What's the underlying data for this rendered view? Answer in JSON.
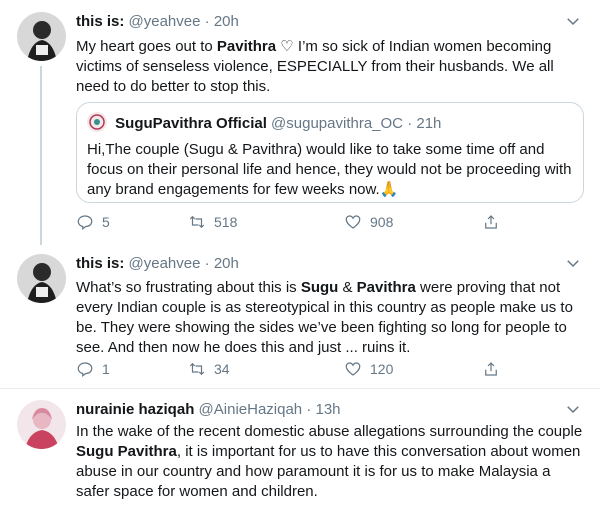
{
  "tweets": [
    {
      "name": "this is:",
      "handle": "@yeahvee",
      "time": "20h",
      "text_parts": [
        "My heart goes out to ",
        "Pavithra",
        " ♡ I’m so sick of Indian women becoming victims of senseless violence, ESPECIALLY from their husbands. We all need to do better to stop this."
      ],
      "quote": {
        "name": "SuguPavithra Official",
        "handle": "@sugupavithra_OC",
        "time": "21h",
        "text": "Hi,The couple (Sugu & Pavithra) would like to take some time off and focus on their personal life and hence, they would not be proceeding with any brand engagements for few weeks now.🙏"
      },
      "replies": "5",
      "retweets": "518",
      "likes": "908"
    },
    {
      "name": "this is:",
      "handle": "@yeahvee",
      "time": "20h",
      "text_parts": [
        "What’s so frustrating about this is ",
        "Sugu",
        " & ",
        "Pavithra",
        " were proving that not every Indian couple is as stereotypical in this country as people make us to be. They were showing the sides we’ve been fighting so long for people to see. And then now he does this and just ... ruins it."
      ],
      "replies": "1",
      "retweets": "34",
      "likes": "120"
    },
    {
      "name": "nurainie haziqah",
      "handle": "@AinieHaziqah",
      "time": "13h",
      "text_parts": [
        "In the wake of the recent domestic abuse allegations surrounding the couple ",
        "Sugu Pavithra",
        ", it is important for us to have this conversation about women abuse in our country and how paramount it is for us to make Malaysia a safer space for women and children."
      ]
    }
  ],
  "colors": {
    "text": "#14171a",
    "secondary": "#657786",
    "border": "#e6ecf0",
    "quote_border": "#ccd6dd"
  }
}
